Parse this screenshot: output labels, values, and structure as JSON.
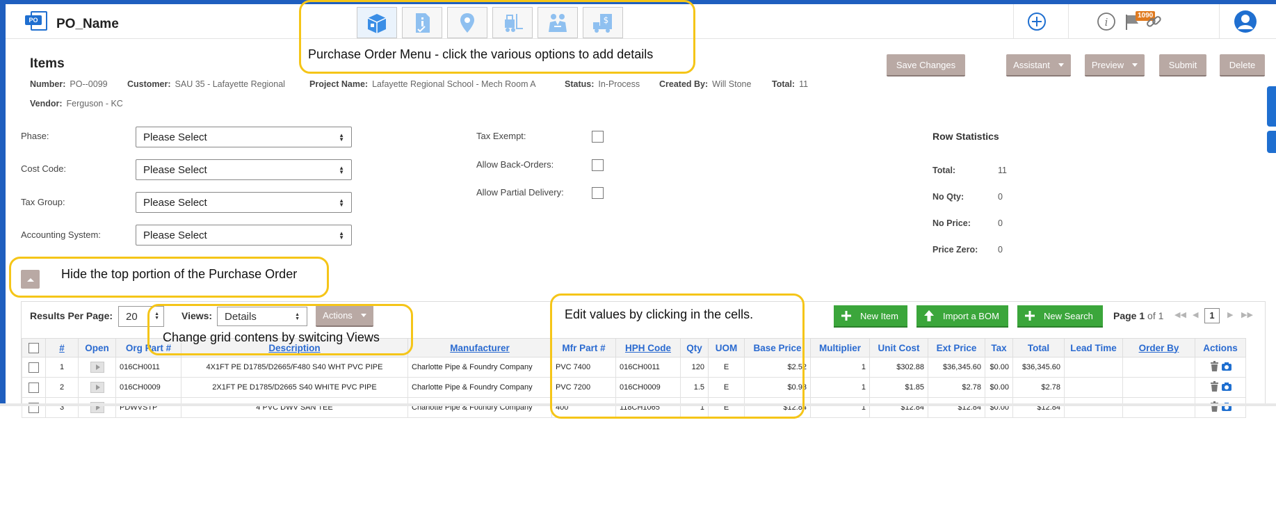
{
  "app": {
    "logo_badge": "PO",
    "title": "PO_Name"
  },
  "po_menu": [
    {
      "icon": "package-icon",
      "active": true
    },
    {
      "icon": "document-info-icon",
      "active": false
    },
    {
      "icon": "location-pin-icon",
      "active": false
    },
    {
      "icon": "forklift-icon",
      "active": false
    },
    {
      "icon": "handshake-icon",
      "active": false
    },
    {
      "icon": "delivery-truck-dollar-icon",
      "active": false
    }
  ],
  "header_icons": {
    "notification_count": "1090"
  },
  "items": {
    "title": "Items",
    "number_label": "Number:",
    "number": "PO--0099",
    "customer_label": "Customer:",
    "customer": "SAU 35 - Lafayette Regional",
    "project_label": "Project Name:",
    "project": "Lafayette Regional School - Mech Room A",
    "status_label": "Status:",
    "status": "In-Process",
    "created_label": "Created By:",
    "created_by": "Will Stone",
    "total_label": "Total:",
    "total": "11",
    "vendor_label": "Vendor:",
    "vendor": "Ferguson - KC"
  },
  "actions": {
    "save_changes": "Save Changes",
    "assistant": "Assistant",
    "preview": "Preview",
    "submit": "Submit",
    "delete": "Delete"
  },
  "form": {
    "phase_label": "Phase:",
    "phase_value": "Please Select",
    "cost_code_label": "Cost Code:",
    "cost_code_value": "Please Select",
    "tax_group_label": "Tax Group:",
    "tax_group_value": "Please Select",
    "accounting_label": "Accounting System:",
    "accounting_value": "Please Select",
    "tax_exempt_label": "Tax Exempt:",
    "allow_backorders_label": "Allow Back-Orders:",
    "allow_partial_label": "Allow Partial Delivery:"
  },
  "row_stats": {
    "title": "Row Statistics",
    "total_label": "Total:",
    "total": "11",
    "no_qty_label": "No Qty:",
    "no_qty": "0",
    "no_price_label": "No Price:",
    "no_price": "0",
    "price_zero_label": "Price Zero:",
    "price_zero": "0"
  },
  "grid_toolbar": {
    "results_per_page_label": "Results Per Page:",
    "results_per_page": "20",
    "views_label": "Views:",
    "views_value": "Details",
    "actions_label": "Actions",
    "new_item": "New Item",
    "import_bom": "Import a BOM",
    "new_search": "New Search",
    "page_label": "Page",
    "page_current": "1",
    "page_of": "of 1",
    "page_input": "1"
  },
  "grid": {
    "columns": [
      "#",
      "Open",
      "Org Part #",
      "Description",
      "Manufacturer",
      "Mfr Part #",
      "HPH Code",
      "Qty",
      "UOM",
      "Base Price",
      "Multiplier",
      "Unit Cost",
      "Ext Price",
      "Tax",
      "Total",
      "Lead Time",
      "Order By",
      "Actions"
    ],
    "rows": [
      {
        "num": "1",
        "org_part": "016CH0011",
        "description": "4X1FT PE D1785/D2665/F480 S40 WHT PVC PIPE",
        "manufacturer": "Charlotte Pipe & Foundry Company",
        "mfr_part": "PVC 7400",
        "hph_code": "016CH0011",
        "qty": "120",
        "uom": "E",
        "base_price": "$2.52",
        "multiplier": "1",
        "unit_cost": "$302.88",
        "ext_price": "$36,345.60",
        "tax": "$0.00",
        "total": "$36,345.60",
        "lead_time": "",
        "order_by": ""
      },
      {
        "num": "2",
        "org_part": "016CH0009",
        "description": "2X1FT PE D1785/D2665 S40 WHITE PVC PIPE",
        "manufacturer": "Charlotte Pipe & Foundry Company",
        "mfr_part": "PVC 7200",
        "hph_code": "016CH0009",
        "qty": "1.5",
        "uom": "E",
        "base_price": "$0.93",
        "multiplier": "1",
        "unit_cost": "$1.85",
        "ext_price": "$2.78",
        "tax": "$0.00",
        "total": "$2.78",
        "lead_time": "",
        "order_by": ""
      },
      {
        "num": "3",
        "org_part": "PDWVSTP",
        "description": "4 PVC DWV SAN TEE",
        "manufacturer": "Charlotte Pipe & Foundry Company",
        "mfr_part": "400",
        "hph_code": "118CH1065",
        "qty": "1",
        "uom": "E",
        "base_price": "$12.84",
        "multiplier": "1",
        "unit_cost": "$12.84",
        "ext_price": "$12.84",
        "tax": "$0.00",
        "total": "$12.84",
        "lead_time": "",
        "order_by": ""
      }
    ]
  },
  "annotations": {
    "po_menu": "Purchase Order Menu - click the various options to add details",
    "hide_top": "Hide the top portion of the Purchase Order",
    "views": "Change grid contens by switcing Views",
    "edit_cells": "Edit values by clicking in the cells."
  },
  "colors": {
    "brand": "#1f6fd0",
    "neutral_button": "#b9a9a4",
    "green_button": "#3ba63b",
    "annotation": "#f5c518",
    "header_link": "#2a6ad0"
  }
}
